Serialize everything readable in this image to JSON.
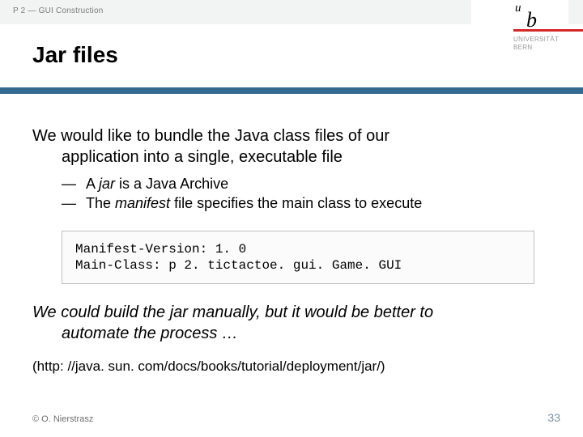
{
  "breadcrumb": "P 2 — GUI Construction",
  "title": "Jar files",
  "logo": {
    "u": "u",
    "b": "b",
    "line1": "UNIVERSITÄT",
    "line2": "BERN"
  },
  "lead": {
    "line1": "We would like to bundle the Java class files of our",
    "line2": "application into a single, executable file"
  },
  "bullets": [
    {
      "dash": "—",
      "pre": "A ",
      "em": "jar",
      "post": " is a Java Archive"
    },
    {
      "dash": "—",
      "pre": "The ",
      "em": "manifest",
      "post": " file specifies the main class to execute"
    }
  ],
  "code": "Manifest-Version: 1. 0\nMain-Class: p 2. tictactoe. gui. Game. GUI",
  "outro": {
    "line1": "We could build the jar manually, but it would be better to",
    "line2": "automate the process …"
  },
  "link": "(http: //java. sun. com/docs/books/tutorial/deployment/jar/)",
  "footer": {
    "copyright": "© O. Nierstrasz",
    "page": "33"
  }
}
